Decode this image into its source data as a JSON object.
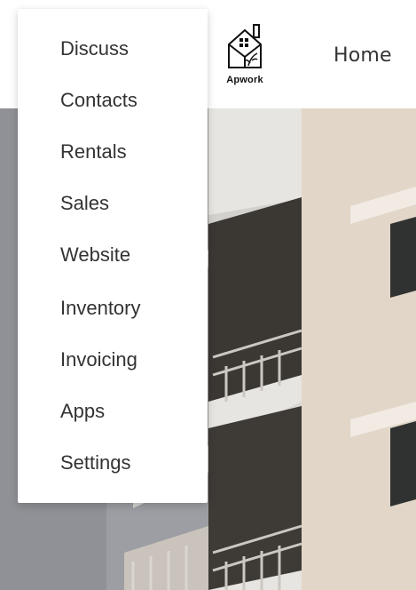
{
  "header": {
    "logo_text": "Apwork",
    "nav_home": "Home"
  },
  "menu": {
    "items": [
      {
        "label": "Discuss"
      },
      {
        "label": "Contacts"
      },
      {
        "label": "Rentals"
      },
      {
        "label": "Sales"
      },
      {
        "label": "Website"
      },
      {
        "label": "Inventory"
      },
      {
        "label": "Invoicing"
      },
      {
        "label": "Apps"
      },
      {
        "label": "Settings"
      }
    ]
  },
  "icons": {
    "logo": "apwork-house-logo-icon"
  }
}
